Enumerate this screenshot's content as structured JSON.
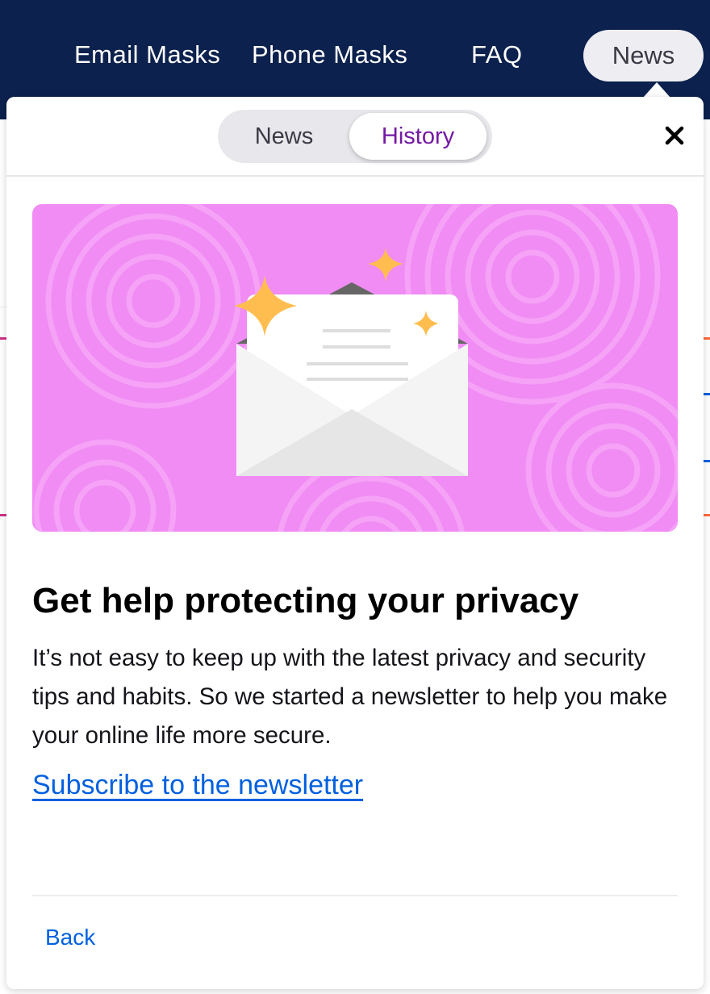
{
  "nav": {
    "items": [
      "Email Masks",
      "Phone Masks",
      "FAQ"
    ],
    "news_label": "News"
  },
  "panel": {
    "tabs": {
      "news": "News",
      "history": "History",
      "active": "History"
    },
    "close_icon": "close-icon",
    "hero_image": "envelope-with-sparkles-illustration",
    "headline": "Get help protecting your privacy",
    "body": "It’s not easy to keep up with the latest privacy and security tips and habits. So we started a newsletter to help you make your online life more secure.",
    "link_label": "Subscribe to the newsletter",
    "back_label": "Back"
  },
  "colors": {
    "nav_bg": "#0c214d",
    "accent_purple": "#7419a3",
    "link_blue": "#0060df",
    "hero_bg": "#f08cf4",
    "sparkle": "#ffbd4f"
  }
}
